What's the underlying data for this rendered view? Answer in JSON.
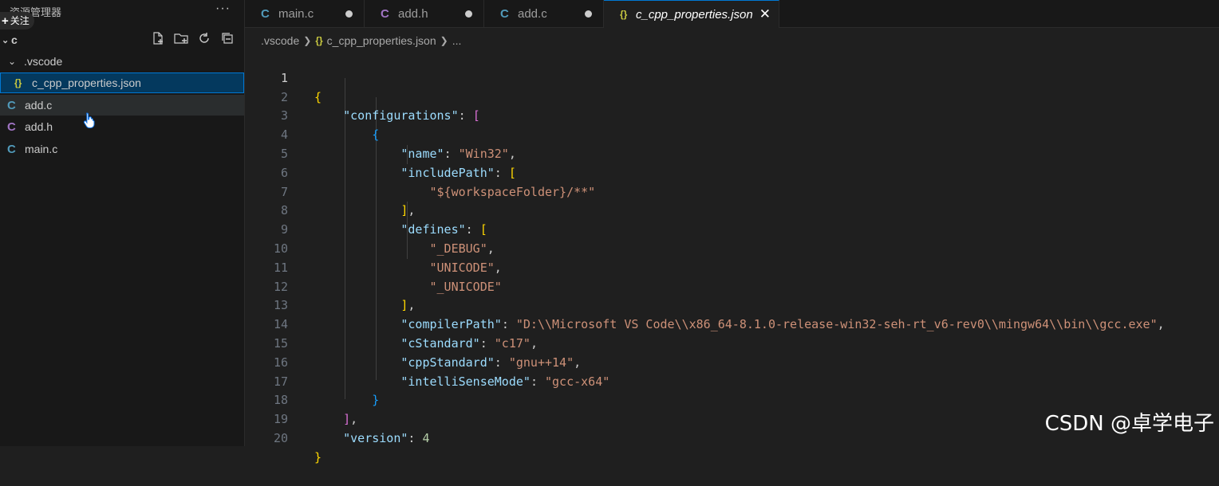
{
  "sidebar": {
    "title": "资源管理器",
    "follow_label": "关注",
    "folder_name": "c",
    "subfolder": ".vscode",
    "files": [
      {
        "name": "c_cpp_properties.json",
        "icon": "{}"
      },
      {
        "name": "add.c",
        "icon": "C"
      },
      {
        "name": "add.h",
        "icon": "C"
      },
      {
        "name": "main.c",
        "icon": "C"
      }
    ]
  },
  "tabs": [
    {
      "label": "main.c",
      "icon": "C"
    },
    {
      "label": "add.h",
      "icon": "C"
    },
    {
      "label": "add.c",
      "icon": "C"
    },
    {
      "label": "c_cpp_properties.json",
      "icon": "{}"
    }
  ],
  "breadcrumb": {
    "folder": ".vscode",
    "file": "c_cpp_properties.json",
    "more": "..."
  },
  "editor": {
    "line_numbers": [
      "1",
      "2",
      "3",
      "4",
      "5",
      "6",
      "7",
      "8",
      "9",
      "10",
      "11",
      "12",
      "13",
      "14",
      "15",
      "16",
      "17",
      "18",
      "19",
      "20"
    ],
    "keys": {
      "configurations": "\"configurations\"",
      "name": "\"name\"",
      "includePath": "\"includePath\"",
      "defines": "\"defines\"",
      "compilerPath": "\"compilerPath\"",
      "cStandard": "\"cStandard\"",
      "cppStandard": "\"cppStandard\"",
      "intelliSenseMode": "\"intelliSenseMode\"",
      "version": "\"version\""
    },
    "values": {
      "name": "\"Win32\"",
      "include_path": "\"${workspaceFolder}/**\"",
      "define_1": "\"_DEBUG\"",
      "define_2": "\"UNICODE\"",
      "define_3": "\"_UNICODE\"",
      "compiler_path": "\"D:\\\\Microsoft VS Code\\\\x86_64-8.1.0-release-win32-seh-rt_v6-rev0\\\\mingw64\\\\bin\\\\gcc.exe\"",
      "c_standard": "\"c17\"",
      "cpp_standard": "\"gnu++14\"",
      "intellisense_mode": "\"gcc-x64\"",
      "version": "4"
    }
  },
  "watermark": "CSDN @卓学电子",
  "colors": {
    "json_key": "#9cdcfe",
    "json_string": "#ce9178",
    "json_number": "#b5cea8",
    "bracket_level1": "#ffd700",
    "bracket_level2": "#da70d6",
    "bracket_level3": "#179fff",
    "c_icon": "#519aba",
    "h_icon": "#a074c4",
    "json_icon": "#cbcb41",
    "selection_border": "#0078d4"
  }
}
